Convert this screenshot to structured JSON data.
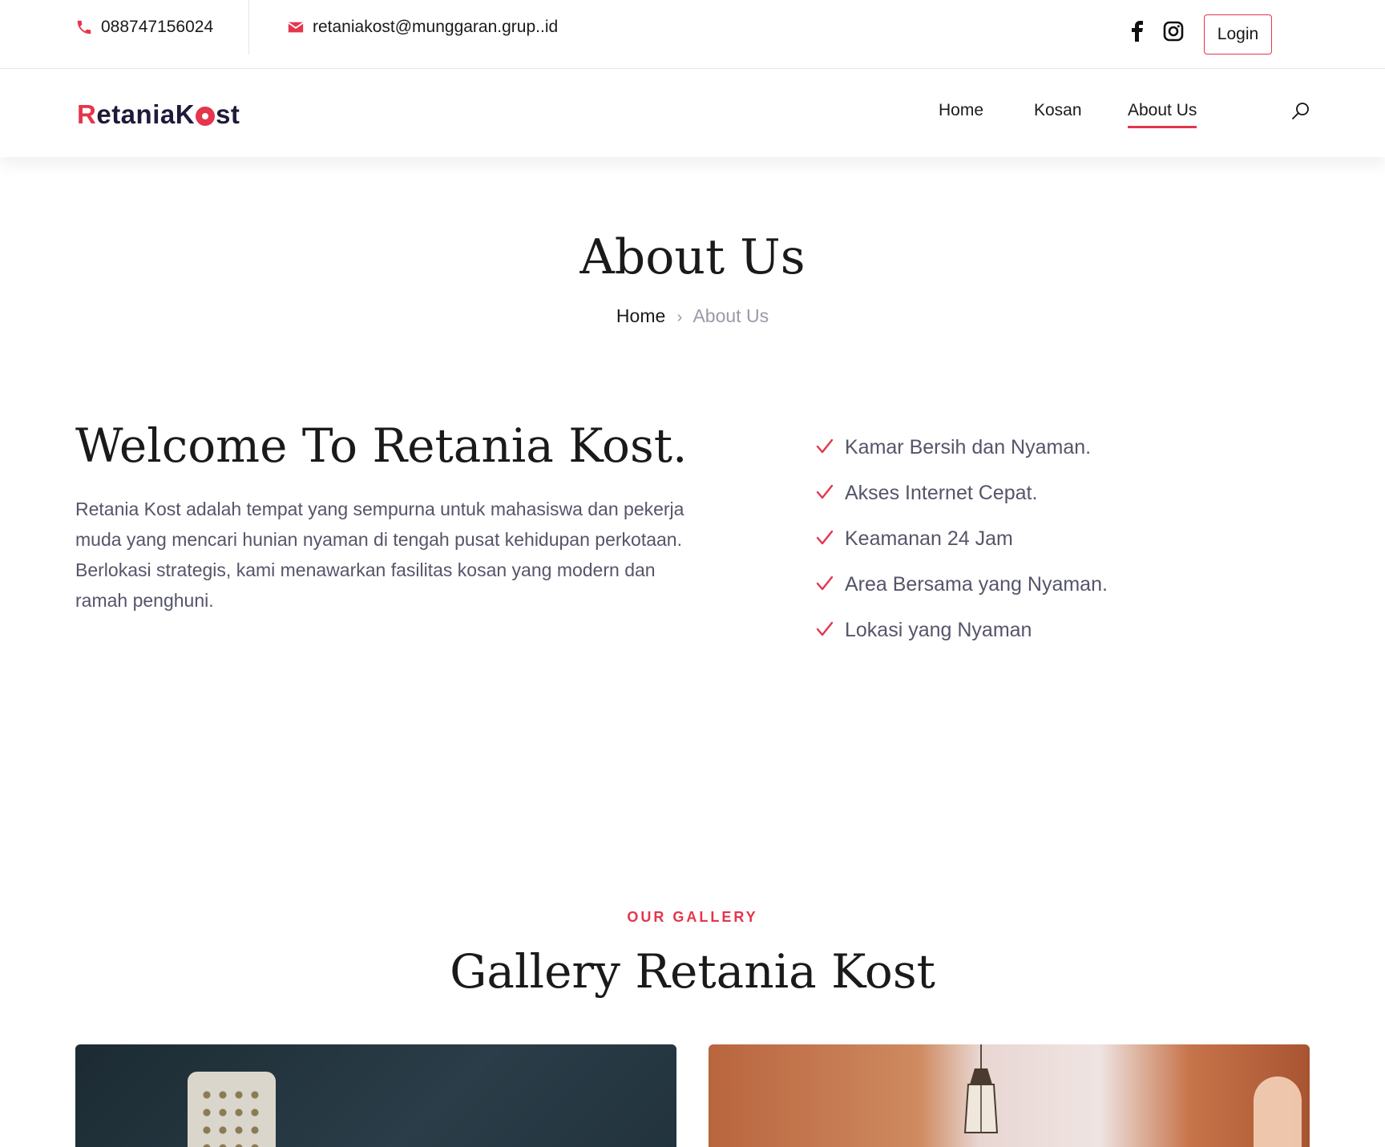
{
  "topbar": {
    "phone": "088747156024",
    "email": "retaniakost@munggaran.grup..id",
    "login_label": "Login",
    "social": [
      "facebook-icon",
      "instagram-icon"
    ]
  },
  "nav": {
    "logo_prefix": "R",
    "logo_mid": "etaniaK",
    "logo_suffix": "st",
    "items": [
      {
        "label": "Home"
      },
      {
        "label": "Kosan"
      },
      {
        "label": "About Us",
        "active": true
      }
    ]
  },
  "hero": {
    "title": "About Us",
    "breadcrumb_home": "Home",
    "breadcrumb_separator": "›",
    "breadcrumb_current": "About Us"
  },
  "welcome": {
    "title": "Welcome To Retania Kost.",
    "text": "Retania Kost adalah tempat yang sempurna untuk mahasiswa dan pekerja muda yang mencari hunian nyaman di tengah pusat kehidupan perkotaan. Berlokasi strategis, kami menawarkan fasilitas kosan yang modern dan ramah penghuni.",
    "features": [
      "Kamar Bersih dan Nyaman.",
      "Akses Internet Cepat.",
      "Keamanan 24 Jam",
      "Area Bersama yang Nyaman.",
      "Lokasi yang Nyaman"
    ]
  },
  "gallery": {
    "eyebrow": "OUR GALLERY",
    "title": "Gallery Retania Kost"
  },
  "colors": {
    "accent": "#e4364d",
    "text": "#1a1a1a",
    "muted": "#55556a",
    "breadcrumb_muted": "#9a9aa8"
  }
}
